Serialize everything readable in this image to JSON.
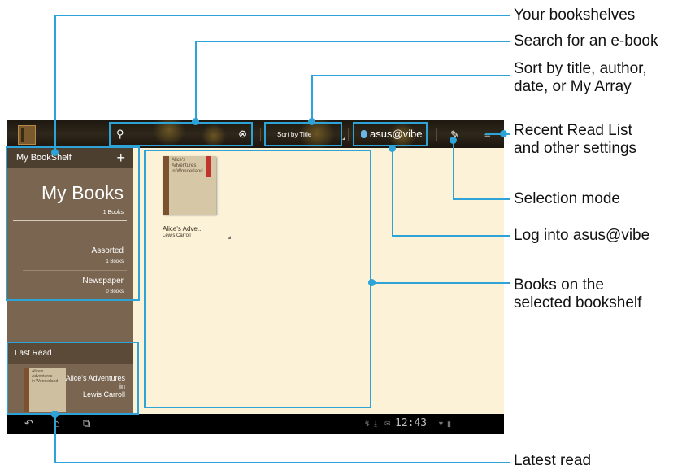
{
  "topbar": {
    "sort_label": "Sort by Title",
    "vibe_label": "asus@vibe"
  },
  "sidebar": {
    "header": "My BookShelf",
    "add_label": "+",
    "my_books_title": "My Books",
    "my_books_count": "1 Books",
    "shelves": [
      {
        "name": "Assorted",
        "count": "1 Books"
      },
      {
        "name": "Newspaper",
        "count": "0 Books"
      }
    ],
    "last_read_header": "Last Read",
    "last_read_cover": [
      "Alice's",
      "Adventures",
      "in Wonderland"
    ],
    "last_read_title": "Alice's Adventures in",
    "last_read_author": "Lewis Carroll"
  },
  "main": {
    "books": [
      {
        "cover_text": [
          "Alice's",
          "Adventures",
          "in Wonderland"
        ],
        "title": "Alice's Adve...",
        "author": "Lewis Carroll"
      }
    ]
  },
  "navbar": {
    "clock": "12:43"
  },
  "annotations": {
    "your_bookshelves": "Your bookshelves",
    "search": "Search for an e-book",
    "sort_line1": "Sort by title, author,",
    "sort_line2": "date, or My Array",
    "recent_line1": "Recent Read List",
    "recent_line2": "and other settings",
    "selection": "Selection mode",
    "login": "Log into asus@vibe",
    "books_line1": "Books on the",
    "books_line2": "selected bookshelf",
    "latest": "Latest read"
  },
  "colors": {
    "callout": "#2da3d8",
    "content_bg": "#fbf2d8",
    "sidebar_bg": "#7a6650"
  }
}
